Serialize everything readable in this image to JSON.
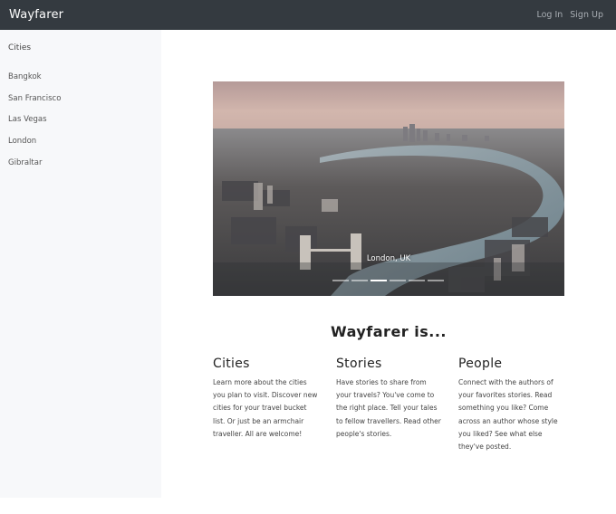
{
  "navbar": {
    "brand": "Wayfarer",
    "login_label": "Log In",
    "signup_label": "Sign Up"
  },
  "sidebar": {
    "title": "Cities",
    "items": [
      {
        "label": "Bangkok"
      },
      {
        "label": "San Francisco"
      },
      {
        "label": "Las Vegas"
      },
      {
        "label": "London"
      },
      {
        "label": "Gibraltar"
      }
    ]
  },
  "carousel": {
    "caption": "London, UK",
    "slide_count": 6,
    "active_slide": 3
  },
  "about": {
    "title": "Wayfarer is...",
    "columns": [
      {
        "heading": "Cities",
        "text": "Learn more about the cities you plan to visit. Discover new cities for your travel bucket list. Or just be an armchair traveller. All are welcome!"
      },
      {
        "heading": "Stories",
        "text": "Have stories to share from your travels? You've come to the right place. Tell your tales to fellow travellers. Read other people's stories."
      },
      {
        "heading": "People",
        "text": "Connect with the authors of your favorites stories. Read something you like? Come across an author whose style you liked? See what else they've posted."
      }
    ]
  },
  "colors": {
    "navbar_bg": "#343a40",
    "sidebar_bg": "#f7f8fa"
  }
}
